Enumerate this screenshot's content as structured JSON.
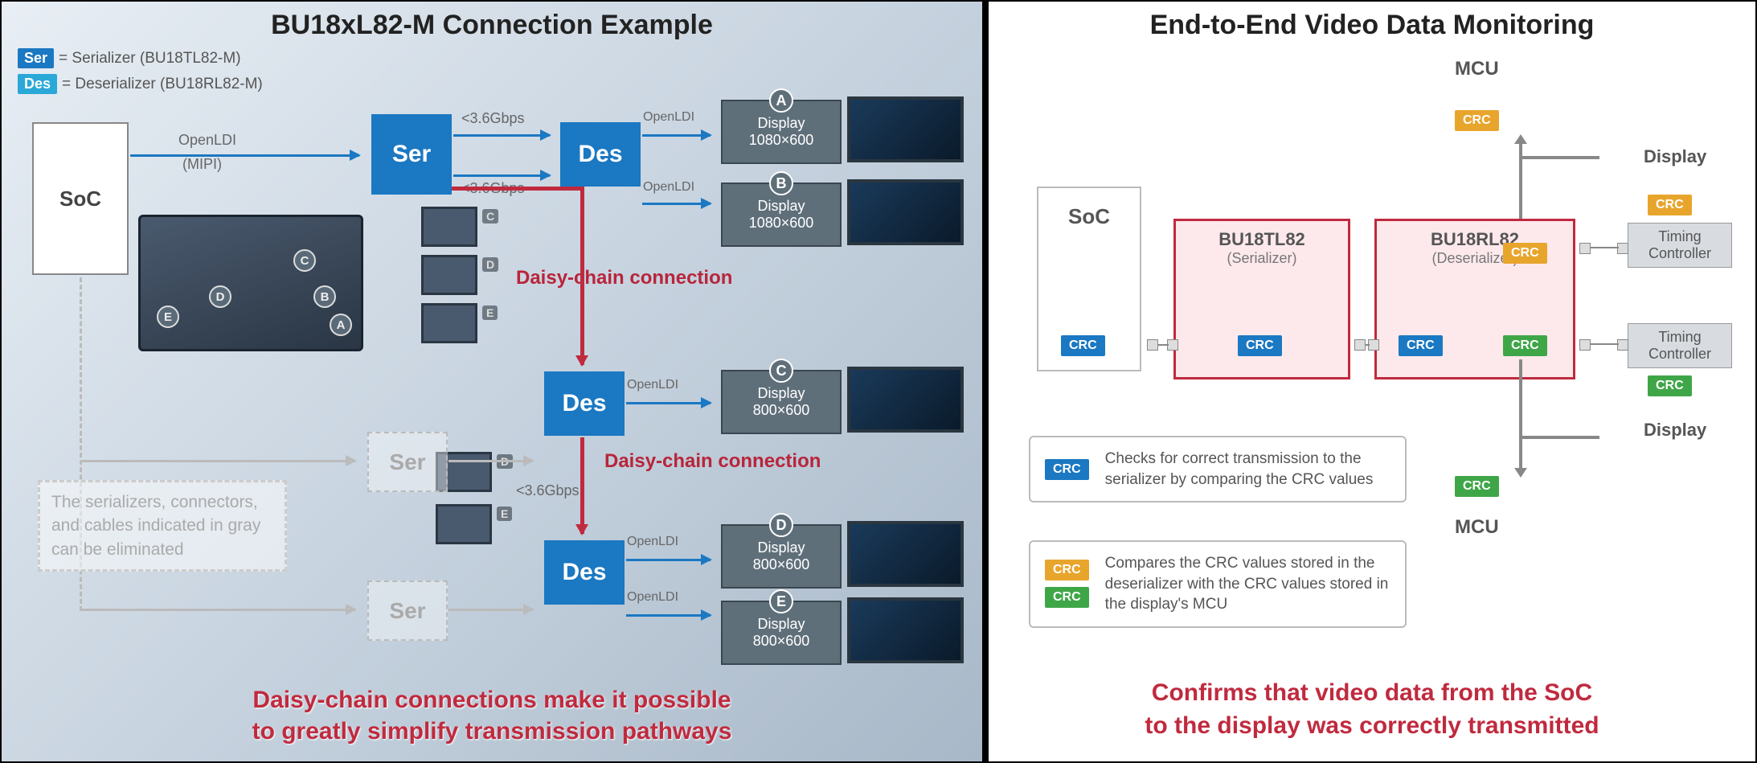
{
  "left": {
    "title": "BU18xL82-M Connection Example",
    "legend_ser_tag": "Ser",
    "legend_ser_text": "= Serializer (BU18TL82-M)",
    "legend_des_tag": "Des",
    "legend_des_text": "= Deserializer (BU18RL82-M)",
    "soc": "SoC",
    "ser": "Ser",
    "des": "Des",
    "openldi_mipi": "OpenLDI",
    "mipi": "(MIPI)",
    "speed": "<3.6Gbps",
    "openldi": "OpenLDI",
    "daisy": "Daisy-chain connection",
    "gray_note": "The serializers, connectors, and cables indicated in gray can be eliminated",
    "displays": {
      "a": {
        "badge": "A",
        "name": "Display",
        "res": "1080×600"
      },
      "b": {
        "badge": "B",
        "name": "Display",
        "res": "1080×600"
      },
      "c": {
        "badge": "C",
        "name": "Display",
        "res": "800×600"
      },
      "d": {
        "badge": "D",
        "name": "Display",
        "res": "800×600"
      },
      "e": {
        "badge": "E",
        "name": "Display",
        "res": "800×600"
      }
    },
    "car_labels": {
      "a": "A",
      "b": "B",
      "c": "C",
      "d": "D",
      "e": "E"
    },
    "bottom_red_1": "Daisy-chain connections make it possible",
    "bottom_red_2": "to greatly simplify transmission pathways"
  },
  "right": {
    "title": "End-to-End Video Data Monitoring",
    "soc": "SoC",
    "ser_name": "BU18TL82",
    "ser_sub": "(Serializer)",
    "des_name": "BU18RL82",
    "des_sub": "(Deserializer)",
    "mcu": "MCU",
    "display": "Display",
    "tc": "Timing Controller",
    "crc": "CRC",
    "note1": "Checks for correct transmission to the serializer by comparing the CRC values",
    "note2": "Compares the CRC values stored in the deserializer with the CRC values stored in the display's MCU",
    "bottom_red_1": "Confirms that video data from the SoC",
    "bottom_red_2": "to the display was correctly transmitted"
  }
}
